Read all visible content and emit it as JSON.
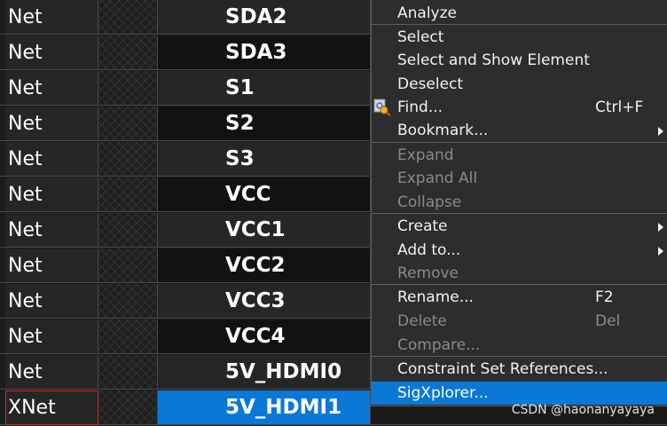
{
  "rows": [
    {
      "type": "Net",
      "name": "SDA2"
    },
    {
      "type": "Net",
      "name": "SDA3"
    },
    {
      "type": "Net",
      "name": "S1"
    },
    {
      "type": "Net",
      "name": "S2"
    },
    {
      "type": "Net",
      "name": "S3"
    },
    {
      "type": "Net",
      "name": "VCC"
    },
    {
      "type": "Net",
      "name": "VCC1"
    },
    {
      "type": "Net",
      "name": "VCC2"
    },
    {
      "type": "Net",
      "name": "VCC3"
    },
    {
      "type": "Net",
      "name": "VCC4"
    },
    {
      "type": "Net",
      "name": "5V_HDMI0"
    },
    {
      "type": "XNet",
      "name": "5V_HDMI1"
    }
  ],
  "menu": {
    "analyze": "Analyze",
    "select": "Select",
    "select_show": "Select and Show Element",
    "deselect": "Deselect",
    "find": "Find...",
    "find_shortcut": "Ctrl+F",
    "bookmark": "Bookmark...",
    "expand": "Expand",
    "expand_all": "Expand All",
    "collapse": "Collapse",
    "create": "Create",
    "add_to": "Add to...",
    "remove": "Remove",
    "rename": "Rename...",
    "rename_shortcut": "F2",
    "delete": "Delete",
    "delete_shortcut": "Del",
    "compare": "Compare...",
    "constraint_set_refs": "Constraint Set References...",
    "sigxplorer": "SigXplorer..."
  },
  "watermark": "CSDN @haonanyayaya"
}
